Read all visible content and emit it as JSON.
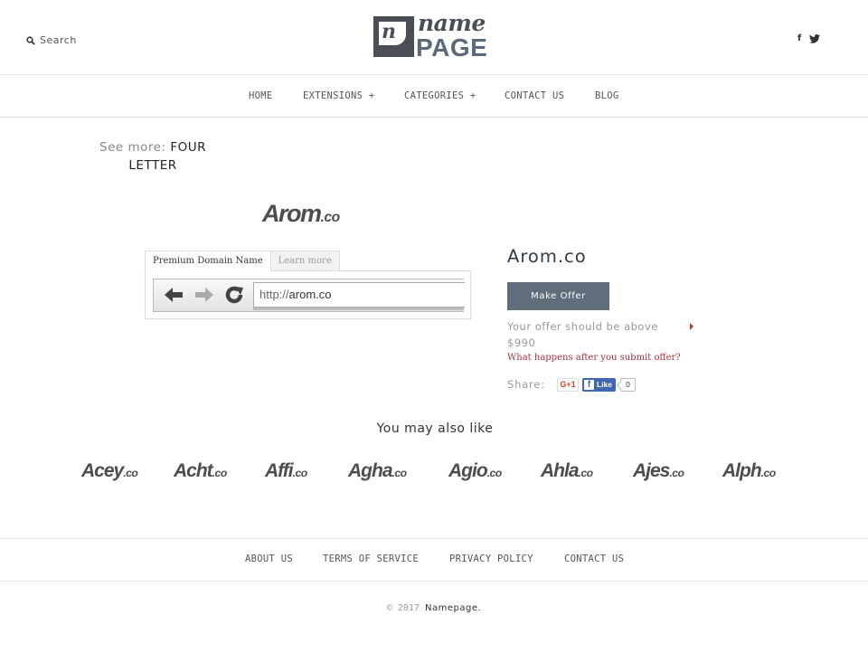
{
  "header": {
    "search_label": "Search",
    "logo": {
      "badge_letter": "n",
      "word_top": "name",
      "word_bottom": "PAGE"
    },
    "social": {
      "facebook_glyph": "f",
      "twitter_icon": "twitter-icon"
    }
  },
  "nav": {
    "items": [
      {
        "label": "HOME"
      },
      {
        "label": "EXTENSIONS +"
      },
      {
        "label": "CATEGORIES +"
      },
      {
        "label": "CONTACT US"
      },
      {
        "label": "BLOG"
      }
    ]
  },
  "see_more": {
    "label": "See more:",
    "value": "FOUR LETTER"
  },
  "domain_logo": {
    "name": "Arom",
    "tld": ".co"
  },
  "tabs": [
    {
      "label": "Premium Domain Name",
      "active": true
    },
    {
      "label": "Learn more",
      "active": false
    }
  ],
  "browser": {
    "url_scheme": "http://",
    "url_host": "arom.co"
  },
  "product": {
    "title": "Arom.co",
    "make_offer_label": "Make Offer",
    "offer_note": "Your offer should be above $990",
    "what_happens_link": "What happens after you submit offer?",
    "share_label": "Share:",
    "gplus_label": "G+1",
    "fb_like_label": "Like",
    "fb_like_count": "0"
  },
  "also_like": {
    "title": "You may also like",
    "items": [
      {
        "name": "Acey",
        "tld": ".co"
      },
      {
        "name": "Acht",
        "tld": ".co"
      },
      {
        "name": "Affi",
        "tld": ".co"
      },
      {
        "name": "Agha",
        "tld": ".co"
      },
      {
        "name": "Agio",
        "tld": ".co"
      },
      {
        "name": "Ahla",
        "tld": ".co"
      },
      {
        "name": "Ajes",
        "tld": ".co"
      },
      {
        "name": "Alph",
        "tld": ".co"
      }
    ]
  },
  "footer": {
    "links": [
      {
        "label": "ABOUT US"
      },
      {
        "label": "TERMS OF SERVICE"
      },
      {
        "label": "PRIVACY POLICY"
      },
      {
        "label": "CONTACT US"
      }
    ],
    "copyright_prefix": "© 2017",
    "copyright_brand": "Namepage."
  },
  "colors": {
    "button_bg": "#606e7b",
    "link_red": "#a8323c",
    "logo_dark": "#4a4f57",
    "logo_blue": "#5a6a79",
    "facebook_blue": "#4267b2",
    "gplus_red": "#d23f31"
  }
}
